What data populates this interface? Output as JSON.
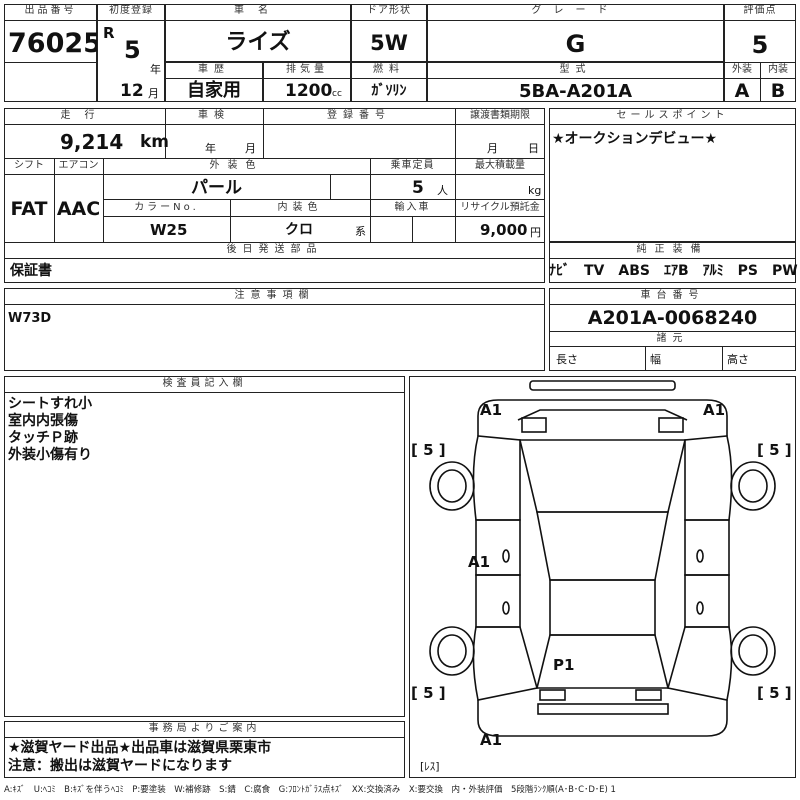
{
  "header": {
    "lot_label": "出品番号",
    "lot_number": "76025",
    "first_reg_label": "初度登録",
    "era": "R",
    "era_year": "5",
    "year_unit": "年",
    "month": "12",
    "month_unit": "月",
    "car_name_label": "車名",
    "car_name": "ライズ",
    "door_label": "ドア形状",
    "door": "5W",
    "grade_label": "グレード",
    "grade": "G",
    "score_label": "評価点",
    "score": "5",
    "history_label": "車歴",
    "history": "自家用",
    "displacement_label": "排気量",
    "displacement": "1200",
    "displacement_unit": "cc",
    "fuel_label": "燃料",
    "fuel": "ｶﾞｿﾘﾝ",
    "model_label": "型式",
    "model": "5BA-A201A",
    "exterior_label": "外装",
    "exterior_grade": "A",
    "interior_label": "内装",
    "interior_grade": "B"
  },
  "row2": {
    "mileage_label": "走行",
    "mileage": "9,214",
    "mileage_unit": "km",
    "inspection_label": "車検",
    "inspection_year_unit": "年",
    "inspection_month_unit": "月",
    "registration_label": "登録番号",
    "transfer_doc_label": "譲渡書類期限",
    "transfer_month_unit": "月",
    "transfer_day_unit": "日",
    "shift_label": "シフト",
    "shift": "FAT",
    "ac_label": "エアコン",
    "ac": "AAC",
    "color_label": "外装色",
    "color": "パール",
    "capacity_label": "乗車定員",
    "capacity": "5",
    "capacity_unit": "人",
    "load_label": "最大積載量",
    "load_unit": "kg",
    "color_no_label": "カラーNo.",
    "color_no": "W25",
    "interior_color_label": "内装色",
    "interior_color": "クロ",
    "interior_color_unit": "系",
    "import_label": "輸入車",
    "recycle_label": "リサイクル預託金",
    "recycle": "9,000",
    "recycle_unit": "円",
    "later_items_label": "後日発送部品",
    "later_items": "保証書"
  },
  "sales_point": {
    "label": "セールスポイント",
    "text": "★オークションデビュー★"
  },
  "equipment": {
    "label": "純正装備",
    "items": "ﾅﾋﾞ　TV　ABS　ｴｱB　ｱﾙﾐ　PS　PW"
  },
  "notes": {
    "label": "注意事項欄",
    "text": "W73D"
  },
  "chassis": {
    "label": "車台番号",
    "number": "A201A-0068240",
    "spec_label": "諸元",
    "length_label": "長さ",
    "width_label": "幅",
    "height_label": "高さ"
  },
  "inspector": {
    "label": "検査員記入欄",
    "lines": [
      "シートすれ小",
      "室内内張傷",
      "タッチＰ跡",
      "外装小傷有り"
    ]
  },
  "office": {
    "label": "事務局よりご案内",
    "line1": "★滋賀ヤード出品★出品車は滋賀県栗東市",
    "line2": "注意：搬出は滋賀ヤードになります"
  },
  "diagram": {
    "marks": {
      "front_left": "A1",
      "front_right": "A1",
      "side_left": "A1",
      "roof": "P1",
      "rear": "A1"
    },
    "tire_scores": {
      "front_left": "[ 5 ]",
      "front_right": "[ 5 ]",
      "rear_left": "[ 5 ]",
      "rear_right": "[ 5 ]",
      "spare": "[ﾚｽ]"
    }
  },
  "legend": "A:ｷｽﾞ　U:ﾍｺﾐ　B:ｷｽﾞを伴うﾍｺﾐ　P:要塗装　W:補修跡　S:錆　C:腐食　G:ﾌﾛﾝﾄｶﾞﾗｽ点ｷｽﾞ　XX:交換済み　X:要交換　内・外装評価　5段階ﾗﾝｸ順(A･B･C･D･E) 1"
}
